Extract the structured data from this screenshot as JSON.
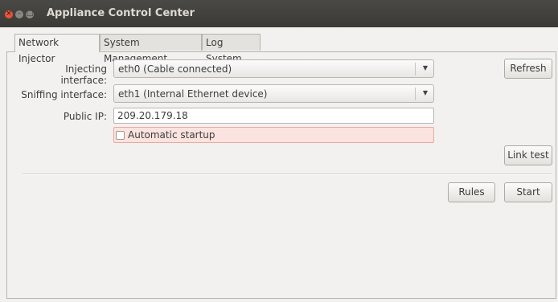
{
  "window": {
    "title": "Appliance Control Center"
  },
  "tabs": [
    {
      "label": "Network Injector",
      "active": true
    },
    {
      "label": "System Management",
      "active": false
    },
    {
      "label": "Log System",
      "active": false
    }
  ],
  "form": {
    "injecting_label": "Injecting interface:",
    "injecting_value": "eth0 (Cable connected)",
    "sniffing_label": "Sniffing interface:",
    "sniffing_value": "eth1 (Internal Ethernet device)",
    "public_ip_label": "Public IP:",
    "public_ip_value": "209.20.179.18",
    "autostart_label": "Automatic startup",
    "autostart_checked": false
  },
  "buttons": {
    "refresh": "Refresh",
    "link_test": "Link test",
    "rules": "Rules",
    "start": "Start"
  },
  "colors": {
    "titlebar": "#3c3b37",
    "close_button": "#e8563a",
    "error_highlight": "#fbe3df"
  },
  "icons": {
    "close": "close-icon",
    "minimize": "minimize-icon",
    "maximize": "maximize-icon",
    "dropdown": "chevron-down-icon"
  }
}
